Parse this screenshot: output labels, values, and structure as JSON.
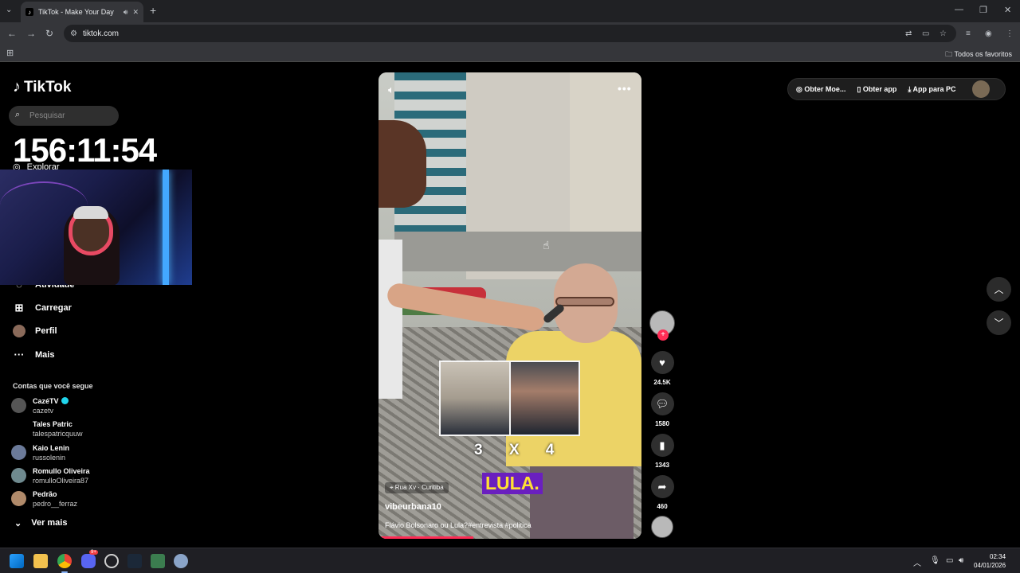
{
  "browser": {
    "tab_title": "TikTok - Make Your Day",
    "tab_audio_icon": "speaker-icon",
    "tab_close": "✕",
    "new_tab": "+",
    "url": "tiktok.com",
    "bookmarks_label": "Todos os favoritos"
  },
  "sidebar": {
    "logo_text": "TikTok",
    "search_placeholder": "Pesquisar",
    "explorar_label": "Explorar",
    "items": [
      {
        "label": "Atividade"
      },
      {
        "label": "Carregar"
      },
      {
        "label": "Perfil"
      },
      {
        "label": "Mais"
      }
    ],
    "following_title": "Contas que você segue",
    "accounts": [
      {
        "name": "CazéTV",
        "handle": "cazetv",
        "verified": true
      },
      {
        "name": "Tales Patric",
        "handle": "talespatricquuw",
        "verified": false
      },
      {
        "name": "Kaio Lenin",
        "handle": "russolenin",
        "verified": false
      },
      {
        "name": "Romullo Oliveira",
        "handle": "romulloOliveira87",
        "verified": false
      },
      {
        "name": "Pedrão",
        "handle": "pedro__ferraz",
        "verified": false
      }
    ],
    "see_more": "Ver mais"
  },
  "overlay": {
    "timer": "156:11:54"
  },
  "video": {
    "score_text": "3 X 4",
    "caption": "LULA.",
    "location": "Rua Xv · Curitiba",
    "username": "vibeurbana10",
    "description": "Flávio Bolsonaro ou Lula?#entrevista #politica",
    "more_icon": "•••",
    "progress": 0.36
  },
  "actions": {
    "likes": "24.5K",
    "comments": "1580",
    "bookmarks": "1343",
    "shares": "460"
  },
  "topbar": {
    "coins": "Obter Moe...",
    "get_app": "Obter app",
    "pc_app": "App para PC"
  },
  "taskbar": {
    "time": "02:34",
    "date": "04/01/2026",
    "discord_badge": "9+"
  },
  "colors": {
    "accent": "#fe2c55",
    "caption_bg": "#6a1fbf",
    "caption_text": "#ffe033"
  }
}
